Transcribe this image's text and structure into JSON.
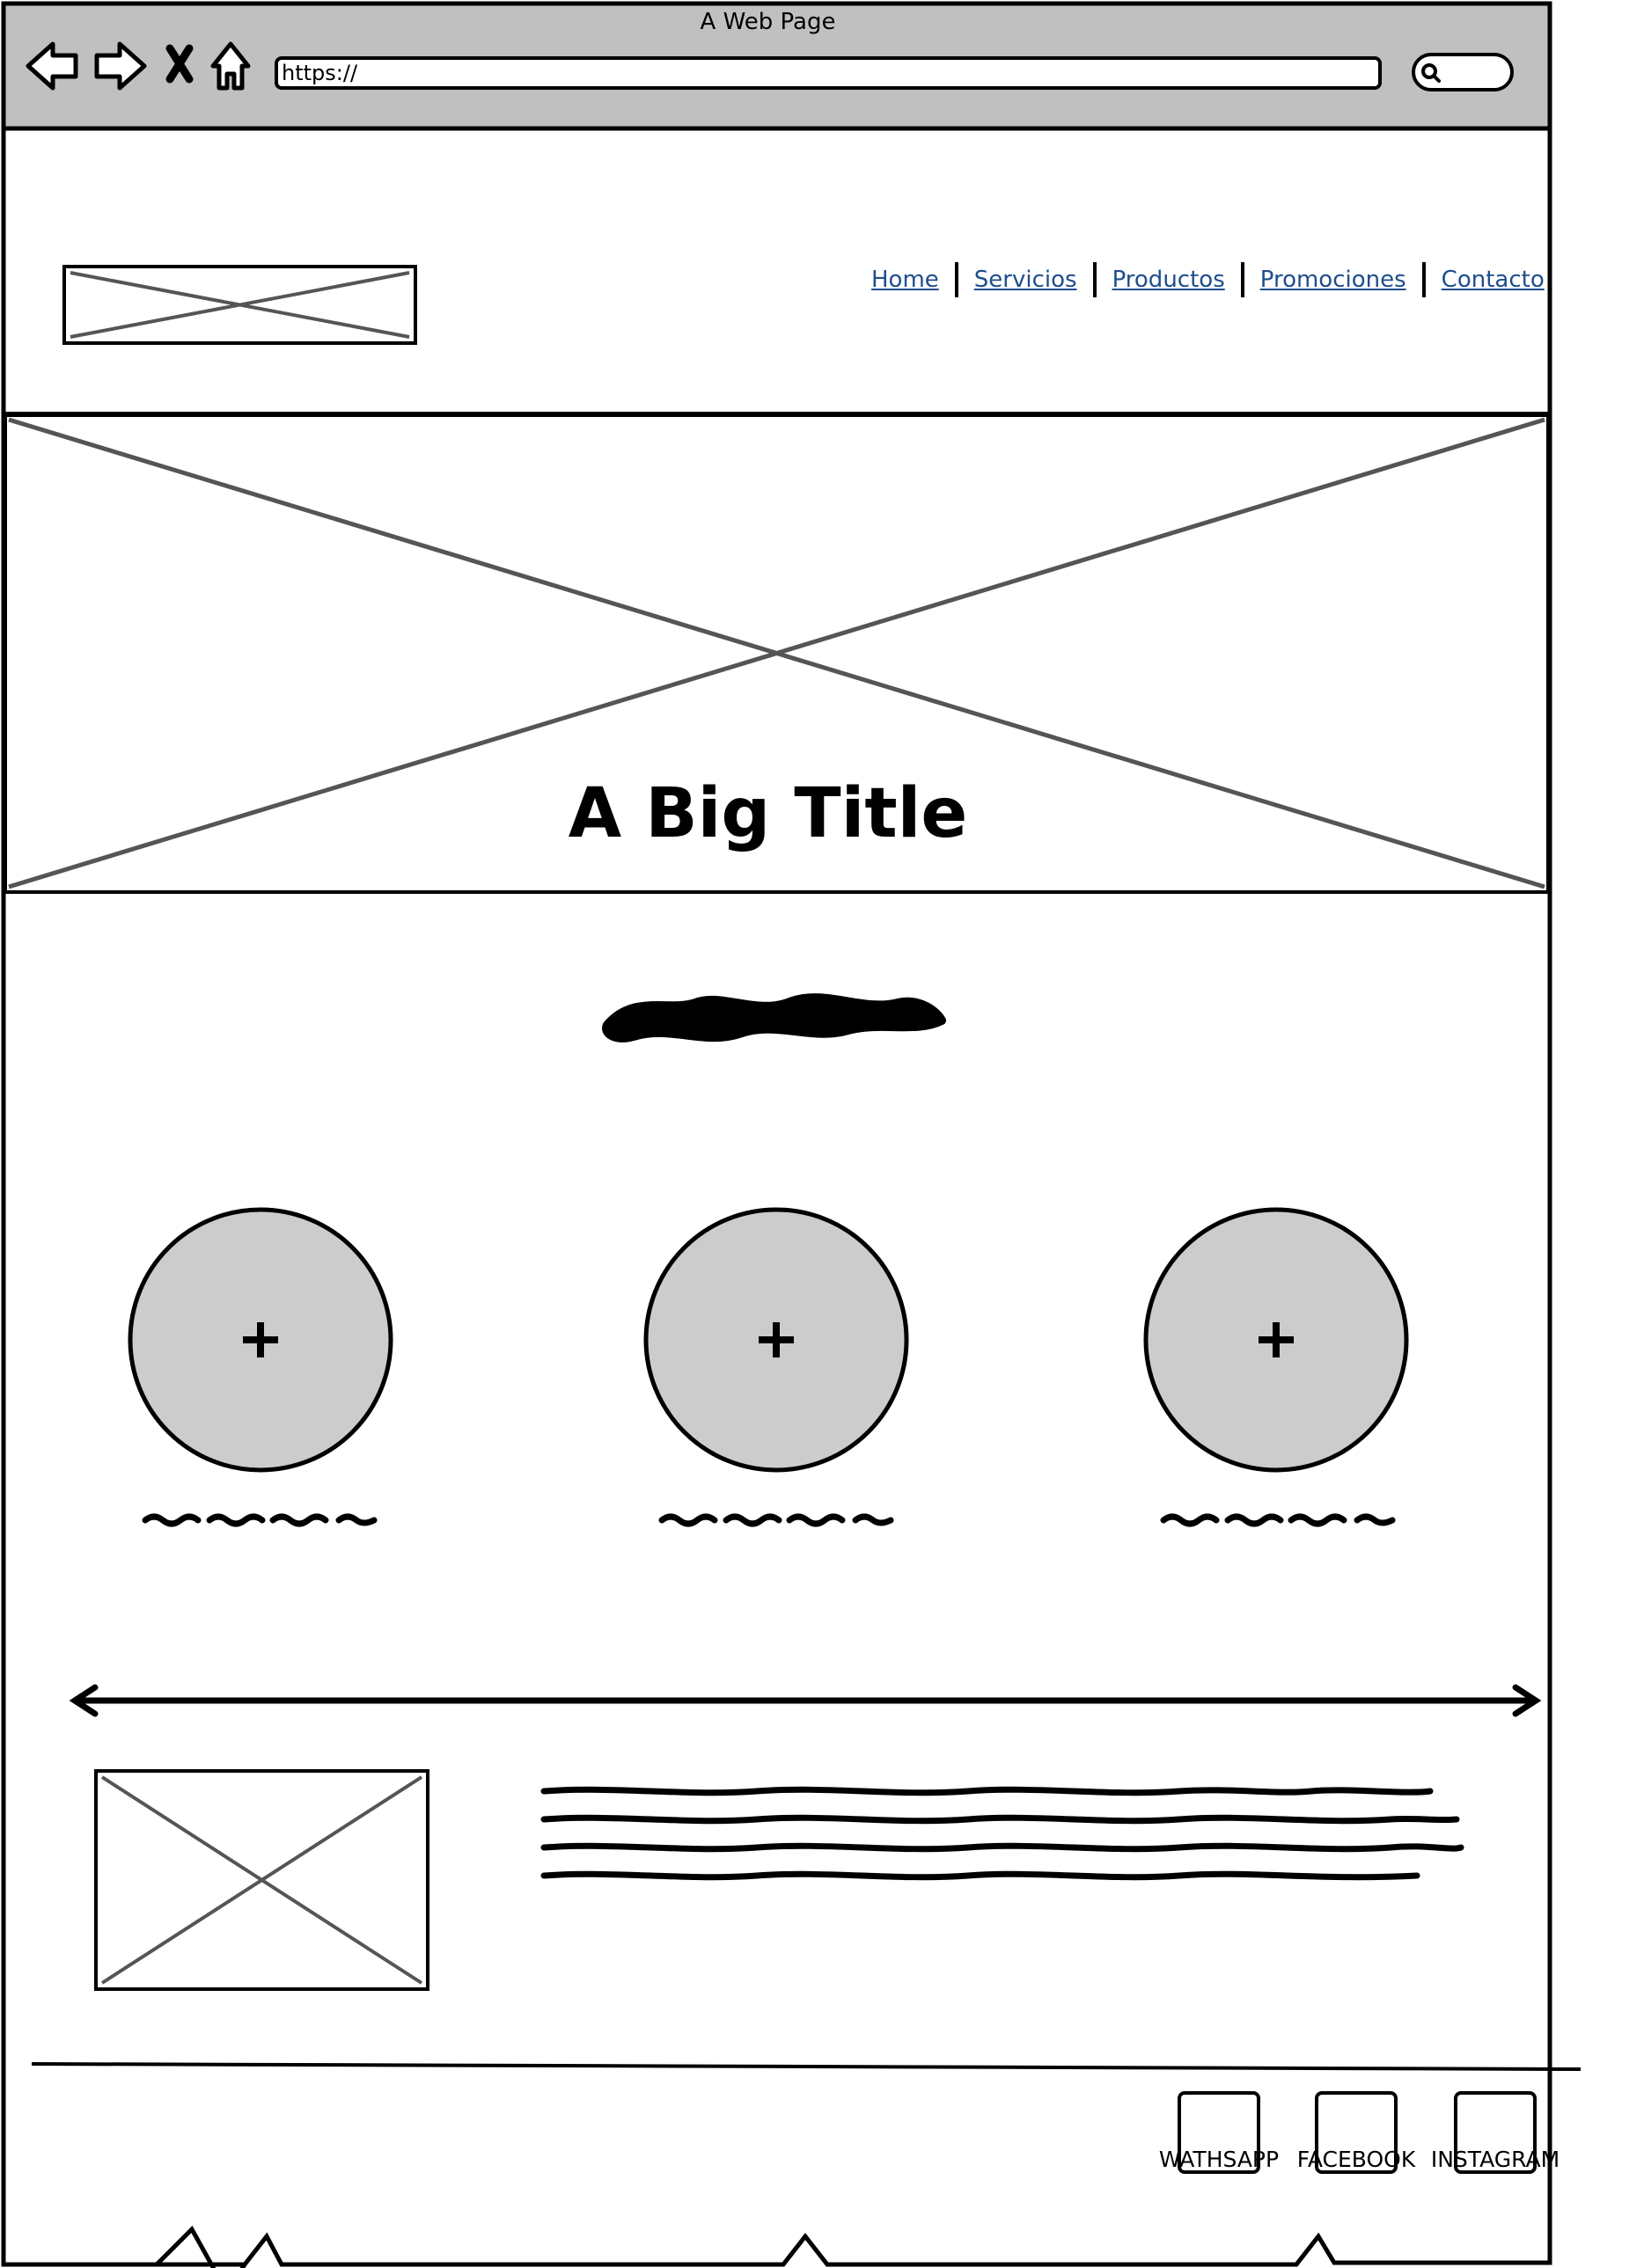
{
  "browser": {
    "window_title": "A Web Page",
    "url": "https://"
  },
  "header": {
    "nav": [
      {
        "label": "Home"
      },
      {
        "label": "Servicios"
      },
      {
        "label": "Productos"
      },
      {
        "label": "Promociones"
      },
      {
        "label": "Contacto"
      }
    ]
  },
  "hero": {
    "title": "A Big Title"
  },
  "footer": {
    "social": [
      {
        "label": "WATHSAPP"
      },
      {
        "label": "FACEBOOK"
      },
      {
        "label": "INSTAGRAM"
      }
    ]
  },
  "icons": {
    "toolbar": [
      "back-icon",
      "forward-icon",
      "close-icon",
      "home-icon",
      "search-icon"
    ],
    "feature": "plus-icon"
  },
  "colors": {
    "chrome": "#c0c0c0",
    "placeholder_line": "#555555",
    "circle_fill": "#cccccc",
    "link": "#1e4e8c"
  }
}
